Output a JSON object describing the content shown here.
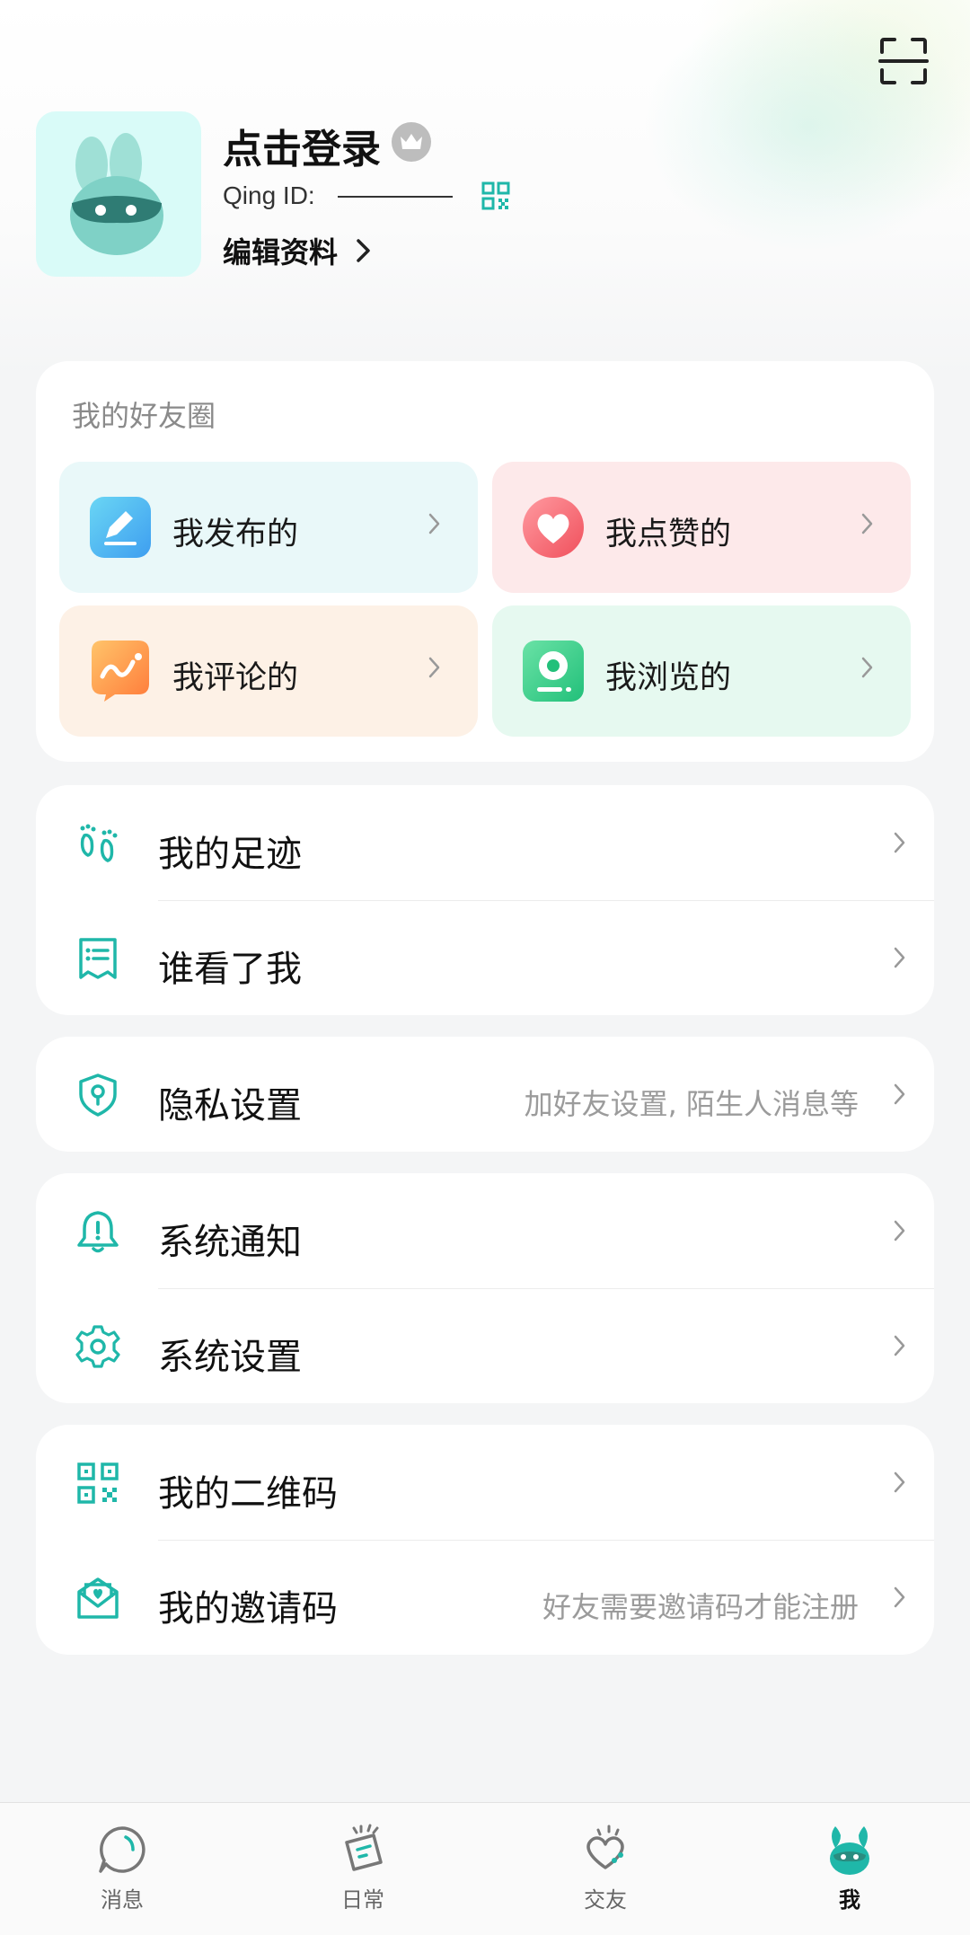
{
  "header": {
    "scan_icon": "scan-icon"
  },
  "profile": {
    "name": "点击登录",
    "qing_id_label": "Qing ID:",
    "qing_id_value": "",
    "edit_label": "编辑资料",
    "avatar_icon": "bunny-avatar-icon",
    "badge_icon": "crown-icon"
  },
  "friend_circle": {
    "title": "我的好友圈",
    "tiles": [
      {
        "label": "我发布的",
        "icon": "edit-icon"
      },
      {
        "label": "我点赞的",
        "icon": "heart-icon"
      },
      {
        "label": "我评论的",
        "icon": "comment-icon"
      },
      {
        "label": "我浏览的",
        "icon": "browse-icon"
      }
    ]
  },
  "menu": {
    "footprint": {
      "label": "我的足迹",
      "icon": "footprint-icon"
    },
    "visitors": {
      "label": "谁看了我",
      "icon": "list-icon"
    },
    "privacy": {
      "label": "隐私设置",
      "sub": "加好友设置, 陌生人消息等",
      "icon": "shield-icon"
    },
    "notifications": {
      "label": "系统通知",
      "icon": "bell-icon"
    },
    "settings": {
      "label": "系统设置",
      "icon": "gear-icon"
    },
    "qrcode": {
      "label": "我的二维码",
      "icon": "qrcode-icon"
    },
    "invite": {
      "label": "我的邀请码",
      "sub": "好友需要邀请码才能注册",
      "icon": "invite-icon"
    }
  },
  "bottom_nav": {
    "items": [
      {
        "label": "消息",
        "icon": "message-icon"
      },
      {
        "label": "日常",
        "icon": "daily-icon"
      },
      {
        "label": "交友",
        "icon": "friends-icon"
      },
      {
        "label": "我",
        "icon": "me-bunny-icon",
        "active": true
      }
    ]
  },
  "colors": {
    "accent": "#1fb7a9",
    "page_bg": "#f4f5f6",
    "card_bg": "#ffffff"
  }
}
